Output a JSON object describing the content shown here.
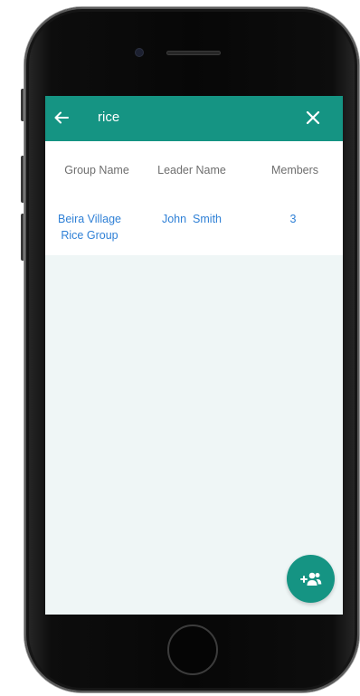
{
  "app_bar": {
    "search_query": "rice",
    "back_icon": "arrow-left-icon",
    "close_icon": "close-icon",
    "color": "#159483"
  },
  "table": {
    "columns": [
      "Group Name",
      "Leader Name",
      "Members"
    ],
    "rows": [
      {
        "group_name_line1": "Beira Village",
        "group_name_line2": "Rice Group",
        "leader_name": "John  Smith",
        "members": "3"
      }
    ]
  },
  "fab": {
    "icon": "add-group-icon",
    "color": "#159483"
  },
  "colors": {
    "accent": "#159483",
    "link": "#2f80d6",
    "screen_background": "#eff6f6"
  }
}
